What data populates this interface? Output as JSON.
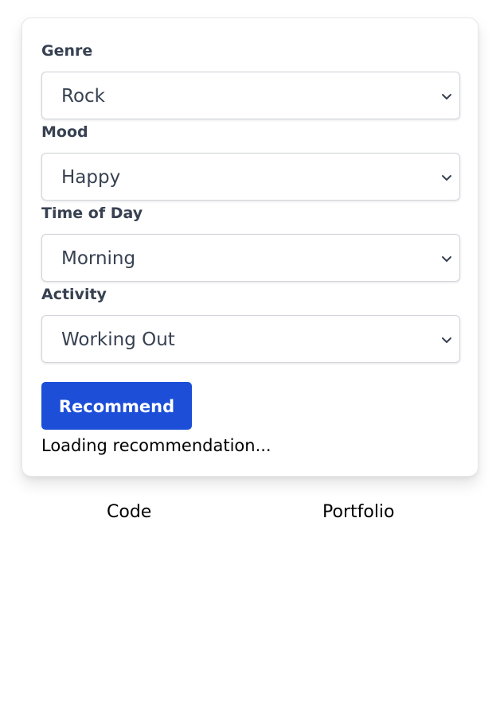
{
  "form": {
    "fields": [
      {
        "label": "Genre",
        "value": "Rock"
      },
      {
        "label": "Mood",
        "value": "Happy"
      },
      {
        "label": "Time of Day",
        "value": "Morning"
      },
      {
        "label": "Activity",
        "value": "Working Out"
      }
    ],
    "submit_label": "Recommend",
    "status_text": "Loading recommendation..."
  },
  "footer": {
    "links": [
      {
        "label": "Code"
      },
      {
        "label": "Portfolio"
      }
    ]
  },
  "colors": {
    "primary_button": "#1d4ed8",
    "label_text": "#374151"
  },
  "icons": {
    "select_indicator": "chevron-down-icon"
  }
}
